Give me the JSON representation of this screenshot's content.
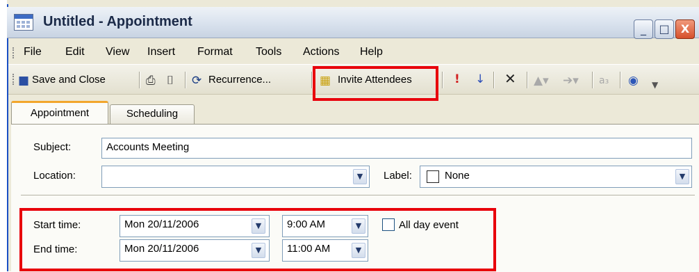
{
  "window": {
    "title": "Untitled - Appointment",
    "controls": {
      "minimize": "_",
      "maximize": "□",
      "close": "X"
    }
  },
  "menu": {
    "items": [
      "File",
      "Edit",
      "View",
      "Insert",
      "Format",
      "Tools",
      "Actions",
      "Help"
    ]
  },
  "toolbar": {
    "save_close": "Save and Close",
    "recurrence": "Recurrence...",
    "invite": "Invite Attendees"
  },
  "tabs": [
    {
      "label": "Appointment",
      "active": true
    },
    {
      "label": "Scheduling",
      "active": false
    }
  ],
  "form": {
    "subject_label": "Subject:",
    "subject_value": "Accounts Meeting",
    "location_label": "Location:",
    "location_value": "",
    "label_label": "Label:",
    "label_value": "None",
    "start_label": "Start time:",
    "start_date": "Mon 20/11/2006",
    "start_time": "9:00 AM",
    "end_label": "End time:",
    "end_date": "Mon 20/11/2006",
    "end_time": "11:00 AM",
    "all_day_label": "All day event",
    "all_day_checked": false
  },
  "colors": {
    "highlight": "#E8000B",
    "active_tab_accent": "#F2A62C",
    "window_face": "#ECE9D8"
  },
  "icons": [
    "calendar-icon",
    "save-icon",
    "print-icon",
    "attach-icon",
    "recurrence-icon",
    "invite-icon",
    "importance-high-icon",
    "importance-low-icon",
    "delete-icon",
    "previous-icon",
    "next-icon",
    "spelling-icon",
    "help-icon",
    "toolbar-options-icon"
  ]
}
